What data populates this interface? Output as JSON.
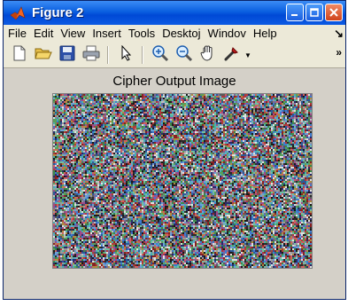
{
  "window": {
    "title": "Figure 2",
    "app_icon": "matlab-logo-icon",
    "buttons": [
      "minimize-icon",
      "maximize-icon",
      "close-icon"
    ]
  },
  "menubar": {
    "items": [
      "File",
      "Edit",
      "View",
      "Insert",
      "Tools",
      "Desktoj",
      "Windov",
      "Help"
    ],
    "overflow": "↘"
  },
  "toolbar": {
    "items": [
      "new-figure-icon",
      "open-file-icon",
      "save-icon",
      "print-icon",
      "pointer-icon",
      "zoom-in-icon",
      "zoom-out-icon",
      "pan-hand-icon",
      "data-cursor-icon"
    ],
    "overflow": "»"
  },
  "figure": {
    "title": "Cipher Output Image",
    "image": "random-color-noise-image"
  },
  "colors": {
    "title_bar": "#0a5fe0",
    "window_bg": "#d4d0c8",
    "menu_bg": "#ece9d8"
  }
}
